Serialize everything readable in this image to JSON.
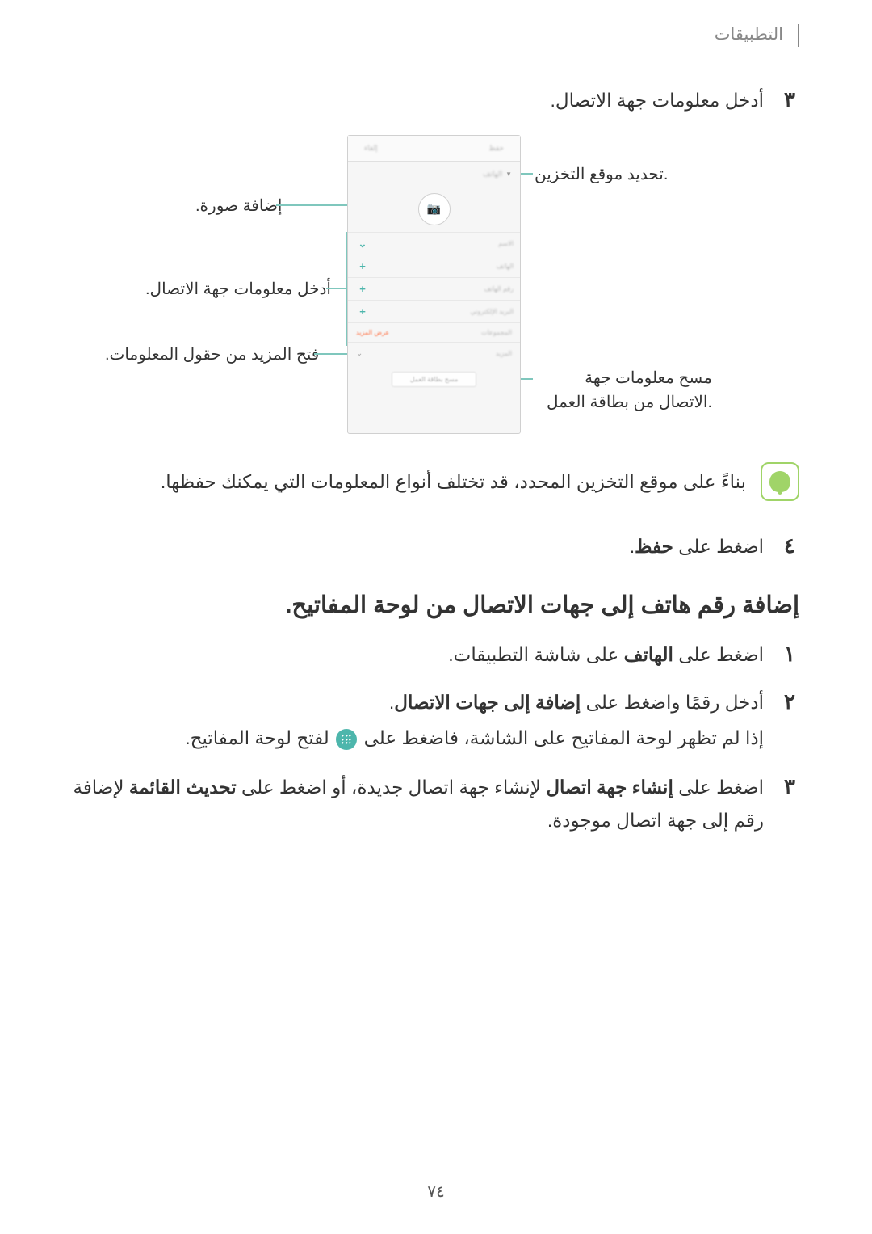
{
  "header": {
    "title": "التطبيقات"
  },
  "step3": {
    "number": "٣",
    "text": "أدخل معلومات جهة الاتصال."
  },
  "diagram": {
    "callouts": {
      "storage": "تحديد موقع التخزين.",
      "addImage": "إضافة صورة.",
      "contactInfo": "أدخل معلومات جهة الاتصال.",
      "moreFields": "فتح المزيد من حقول المعلومات.",
      "scanCard": "مسح معلومات جهة الاتصال من بطاقة العمل."
    },
    "phone": {
      "headerLeft": "إلغاء",
      "headerRight": "حفظ",
      "storageLabel": "الهاتف",
      "scanButton": "مسح بطاقة العمل",
      "groupsLeft": "عرض المزيد",
      "groupsRight": "المجموعات",
      "moreRight": "المزيد"
    }
  },
  "note": {
    "text": "بناءً على موقع التخزين المحدد، قد تختلف أنواع المعلومات التي يمكنك حفظها."
  },
  "step4": {
    "number": "٤",
    "textPrefix": "اضغط على ",
    "textBold": "حفظ",
    "textSuffix": "."
  },
  "section2": {
    "heading": "إضافة رقم هاتف إلى جهات الاتصال من لوحة المفاتيح.",
    "step1": {
      "number": "١",
      "textPrefix": "اضغط على ",
      "textBold": "الهاتف",
      "textSuffix": " على شاشة التطبيقات."
    },
    "step2": {
      "number": "٢",
      "textPrefix": "أدخل رقمًا واضغط على ",
      "textBold": "إضافة إلى جهات الاتصال",
      "textSuffix": ".",
      "subPrefix": "إذا لم تظهر لوحة المفاتيح على الشاشة، فاضغط على ",
      "subSuffix": " لفتح لوحة المفاتيح."
    },
    "step3": {
      "number": "٣",
      "textPrefix": "اضغط على ",
      "textBold1": "إنشاء جهة اتصال",
      "textMiddle": " لإنشاء جهة اتصال جديدة، أو اضغط على ",
      "textBold2": "تحديث القائمة",
      "textSuffix": " لإضافة رقم إلى جهة اتصال موجودة."
    }
  },
  "pageNumber": "٧٤"
}
